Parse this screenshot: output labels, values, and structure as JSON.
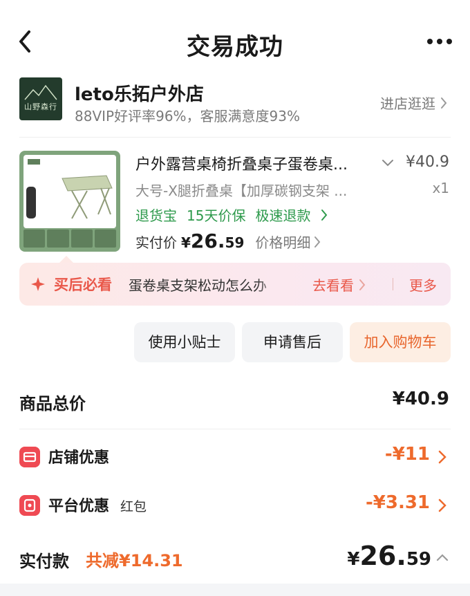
{
  "nav": {
    "title": "交易成功"
  },
  "shop": {
    "logo_text": "山野森行",
    "name": "leto乐拓户外店",
    "rating": "88VIP好评率96%，客服满意度93%",
    "enter_label": "进店逛逛"
  },
  "product": {
    "title": "户外露营桌椅折叠桌子蛋卷桌...",
    "price": "¥40.9",
    "spec": "大号-X腿折叠桌【加厚碳钢支架 ...",
    "qty": "x1",
    "services": [
      "退货宝",
      "15天价保",
      "极速退款"
    ],
    "paid_label": "实付价",
    "paid_yen": "¥",
    "paid_int": "26.",
    "paid_dec": "59",
    "detail_label": "价格明细"
  },
  "tip": {
    "title": "买后必看",
    "message": "蛋卷桌支架松动怎么办",
    "go_label": "去看看",
    "more_label": "更多"
  },
  "actions": {
    "tips_label": "使用小贴士",
    "after_sale_label": "申请售后",
    "cart_label": "加入购物车"
  },
  "summary": {
    "total_label": "商品总价",
    "total_value": "¥40.9",
    "shop_discount_label": "店铺优惠",
    "shop_discount_value": "-¥11",
    "platform_discount_label": "平台优惠",
    "platform_discount_sub": "红包",
    "platform_discount_value": "-¥3.31",
    "paid_label": "实付款",
    "saved_label": "共减¥14.31",
    "paid_yen": "¥",
    "paid_int": "26.",
    "paid_dec": "59"
  },
  "colors": {
    "accent_orange": "#ee6a2c",
    "service_green": "#2e9a4c",
    "tip_red": "#e9584a",
    "discount_icon_red": "#ef4a53"
  },
  "icons": {
    "back": "chevron-left-icon",
    "more": "more-dots-icon",
    "sparkle": "sparkle-icon",
    "shop_discount": "shop-coupon-icon",
    "platform_discount": "red-packet-icon"
  }
}
